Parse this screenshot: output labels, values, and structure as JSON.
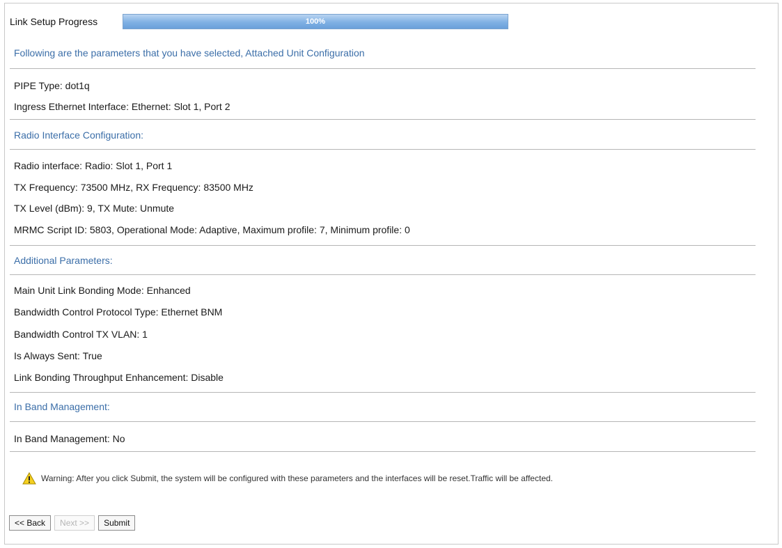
{
  "progress": {
    "label": "Link Setup Progress",
    "percent_text": "100%",
    "value": 1.0
  },
  "intro": "Following are the parameters that you have selected, Attached Unit Configuration",
  "attached": [
    "PIPE Type: dot1q",
    "Ingress Ethernet Interface: Ethernet: Slot 1, Port 2"
  ],
  "radio": {
    "heading": "Radio Interface Configuration:",
    "lines": [
      "Radio interface: Radio: Slot 1, Port 1",
      "TX Frequency: 73500 MHz, RX Frequency: 83500 MHz",
      "TX Level (dBm): 9, TX Mute: Unmute",
      "MRMC Script ID: 5803, Operational Mode: Adaptive, Maximum profile: 7, Minimum profile: 0"
    ]
  },
  "additional": {
    "heading": "Additional Parameters:",
    "lines": [
      "Main Unit Link Bonding Mode: Enhanced",
      "Bandwidth Control Protocol Type: Ethernet BNM",
      "Bandwidth Control TX VLAN: 1",
      "Is Always Sent: True",
      "Link Bonding Throughput Enhancement: Disable"
    ]
  },
  "inband": {
    "heading": "In Band Management:",
    "lines": [
      "In Band Management: No"
    ]
  },
  "warning": "Warning: After you click Submit, the system will be configured with these parameters and the interfaces will be reset.Traffic will be affected.",
  "buttons": {
    "back": "<< Back",
    "next": "Next >>",
    "submit": "Submit"
  },
  "colors": {
    "section_heading": "#3b6ea8",
    "progress_fill": "#7fb0e4",
    "warning_icon": "#f5d020"
  }
}
